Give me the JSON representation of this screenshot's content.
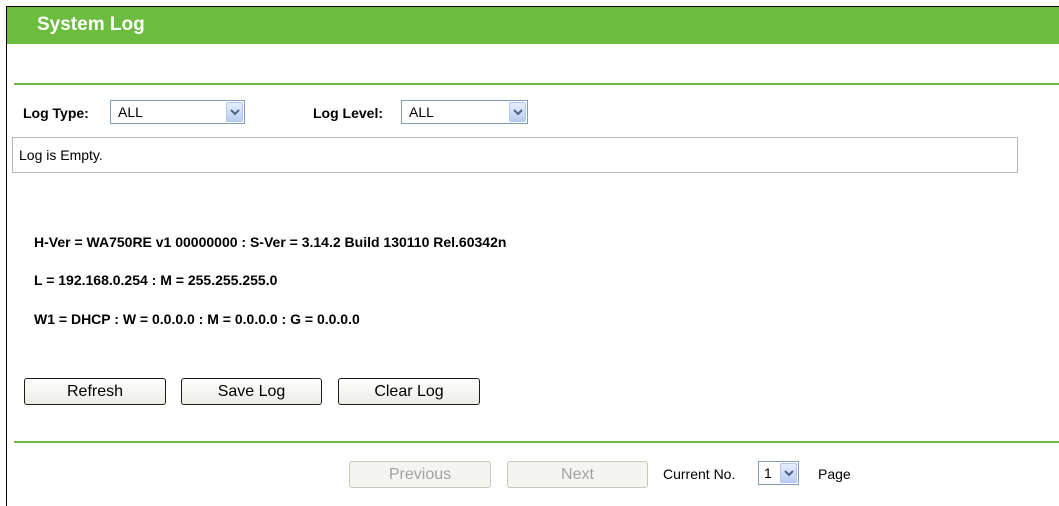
{
  "header": {
    "title": "System Log"
  },
  "filters": {
    "log_type_label": "Log Type:",
    "log_type_value": "ALL",
    "log_level_label": "Log Level:",
    "log_level_value": "ALL"
  },
  "log": {
    "text": "Log is Empty."
  },
  "info": {
    "line1": "H-Ver = WA750RE v1 00000000 : S-Ver = 3.14.2 Build 130110 Rel.60342n",
    "line2": "L = 192.168.0.254 : M = 255.255.255.0",
    "line3": "W1 = DHCP : W = 0.0.0.0 : M = 0.0.0.0 : G = 0.0.0.0"
  },
  "actions": {
    "refresh": "Refresh",
    "save": "Save Log",
    "clear": "Clear Log"
  },
  "pagination": {
    "previous": "Previous",
    "next": "Next",
    "current_label": "Current No.",
    "current_value": "1",
    "page_label": "Page"
  },
  "colors": {
    "accent": "#6cbc3f",
    "select_border": "#7f9db9"
  },
  "icons": {
    "dropdown": "chevron-down-icon"
  }
}
